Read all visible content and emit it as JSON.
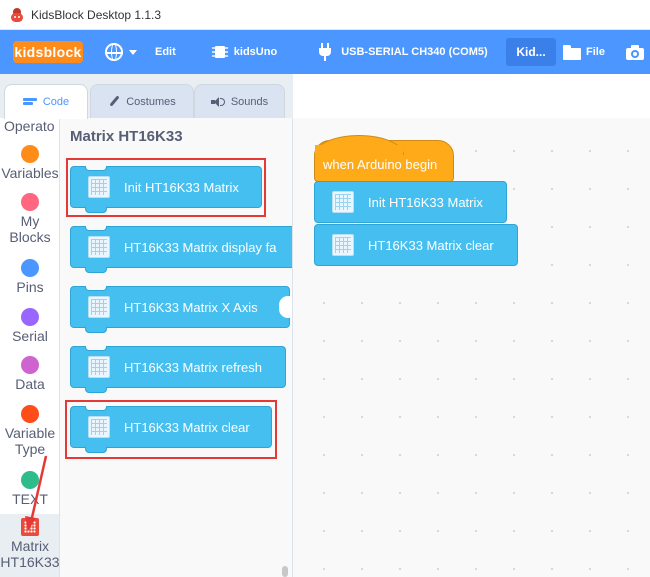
{
  "window": {
    "title": "KidsBlock Desktop 1.1.3"
  },
  "menubar": {
    "logo": "kidsblock",
    "edit_label": "Edit",
    "board_label": "kidsUno",
    "port_label": "USB-SERIAL CH340 (COM5)",
    "kid_label": "Kid...",
    "file_label": "File",
    "accent_color": "#4c97ff"
  },
  "tabs": [
    {
      "label": "Code",
      "icon": "code-icon",
      "active": true
    },
    {
      "label": "Costumes",
      "icon": "brush-icon",
      "active": false
    },
    {
      "label": "Sounds",
      "icon": "sound-icon",
      "active": false
    }
  ],
  "categories": {
    "operators_partial": "Operato",
    "variables": {
      "label": "Variables",
      "color": "#ff8c1a"
    },
    "my_blocks": {
      "label_line1": "My",
      "label_line2": "Blocks",
      "color": "#ff6680"
    },
    "pins": {
      "label": "Pins",
      "color": "#4c97ff"
    },
    "serial": {
      "label": "Serial",
      "color": "#9966ff"
    },
    "data": {
      "label": "Data",
      "color": "#cf63cf"
    },
    "variable_type": {
      "label_line1": "Variable",
      "label_line2": "Type",
      "color": "#ff4d1a"
    },
    "text": {
      "label": "TEXT",
      "color": "#2ebd8a"
    },
    "matrix": {
      "label_line1": "Matrix",
      "label_line2": "HT16K33",
      "icon": "matrix-icon",
      "selected": true
    }
  },
  "flyout": {
    "title": "Matrix HT16K33",
    "blocks": {
      "init": "Init HT16K33 Matrix",
      "display": "HT16K33 Matrix display fa",
      "x_axis": "HT16K33 Matrix X Axis",
      "refresh": "HT16K33 Matrix refresh",
      "clear": "HT16K33 Matrix clear"
    }
  },
  "workspace": {
    "hat_label": "when Arduino begin",
    "block_init": "Init HT16K33 Matrix",
    "block_clear": "HT16K33 Matrix clear"
  }
}
